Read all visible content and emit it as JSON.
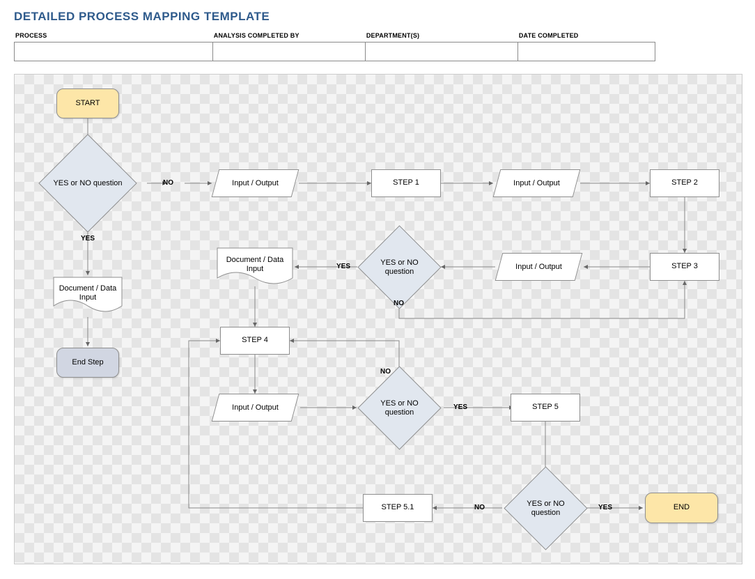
{
  "title": "DETAILED PROCESS MAPPING TEMPLATE",
  "form": {
    "process_label": "PROCESS",
    "analysis_label": "ANALYSIS COMPLETED BY",
    "department_label": "DEPARTMENT(S)",
    "date_label": "DATE COMPLETED",
    "process_value": "",
    "analysis_value": "",
    "department_value": "",
    "date_value": ""
  },
  "nodes": {
    "start": "START",
    "q1": "YES or NO question",
    "q1_yes": "YES",
    "q1_no": "NO",
    "io1": "Input / Output",
    "step1": "STEP 1",
    "io2": "Input / Output",
    "step2": "STEP 2",
    "step3": "STEP 3",
    "io3": "Input / Output",
    "q2": "YES or NO question",
    "q2_yes": "YES",
    "q2_no": "NO",
    "doc2": "Document / Data Input",
    "doc1": "Document / Data Input",
    "endstep": "End Step",
    "step4": "STEP 4",
    "io4": "Input / Output",
    "q3": "YES or NO question",
    "q3_yes": "YES",
    "q3_no": "NO",
    "step5": "STEP 5",
    "q4": "YES or NO question",
    "q4_yes": "YES",
    "q4_no": "NO",
    "step51": "STEP 5.1",
    "end": "END"
  }
}
